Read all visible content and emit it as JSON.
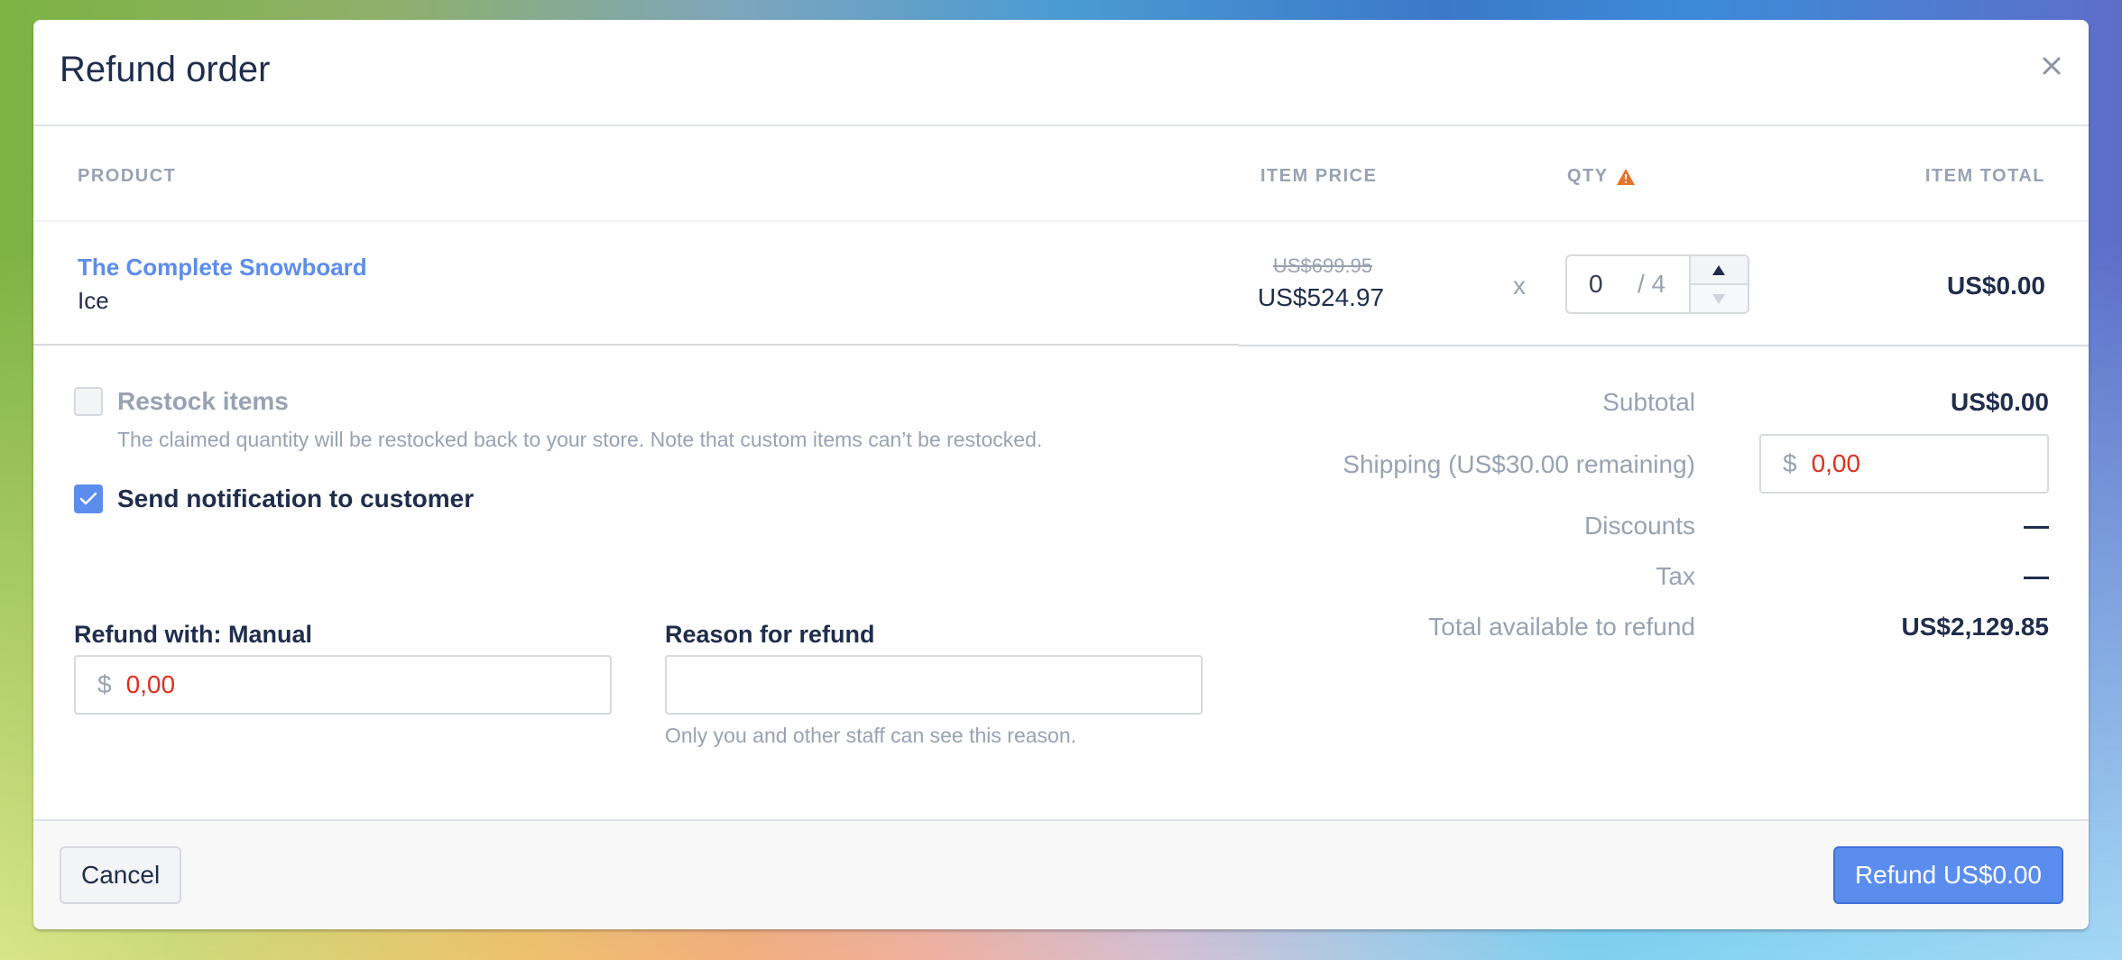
{
  "modal": {
    "title": "Refund order",
    "close_icon": "close-icon"
  },
  "table": {
    "headers": {
      "product": "PRODUCT",
      "item_price": "ITEM PRICE",
      "qty": "QTY",
      "item_total": "ITEM TOTAL"
    },
    "qty_warning_icon": "warning-triangle-icon",
    "rows": [
      {
        "product_name": "The Complete Snowboard",
        "variant": "Ice",
        "original_price": "US$699.95",
        "price": "US$524.97",
        "multiply_symbol": "x",
        "qty_value": "0",
        "qty_max": "/ 4",
        "item_total": "US$0.00"
      }
    ]
  },
  "options": {
    "restock": {
      "label": "Restock items",
      "checked": false,
      "help": "The claimed quantity will be restocked back to your store. Note that custom items can’t be restocked."
    },
    "notify": {
      "label": "Send notification to customer",
      "checked": true
    }
  },
  "refund_with": {
    "label": "Refund with: Manual",
    "currency": "$",
    "value": "0,00"
  },
  "reason": {
    "label": "Reason for refund",
    "value": "",
    "help": "Only you and other staff can see this reason."
  },
  "summary": {
    "subtotal_label": "Subtotal",
    "subtotal_value": "US$0.00",
    "shipping_label": "Shipping (US$30.00 remaining)",
    "shipping_currency": "$",
    "shipping_value": "0,00",
    "discounts_label": "Discounts",
    "discounts_value": "—",
    "tax_label": "Tax",
    "tax_value": "—",
    "total_label": "Total available to refund",
    "total_value": "US$2,129.85"
  },
  "footer": {
    "cancel_label": "Cancel",
    "refund_label": "Refund US$0.00"
  },
  "colors": {
    "accent": "#5b8def",
    "text_dark": "#1f2d4d",
    "text_muted": "#98a2b3",
    "error_red": "#e0301e",
    "warning_orange": "#e8722c"
  }
}
